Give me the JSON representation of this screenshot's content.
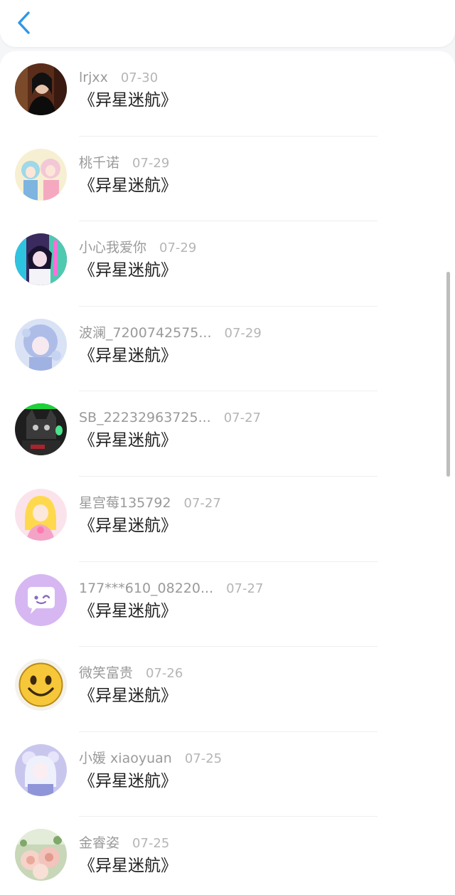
{
  "header": {
    "back_icon": "chevron-left-icon",
    "accent": "#2f96e6"
  },
  "items": [
    {
      "username": "lrjxx",
      "date": "07-30",
      "title": "《异星迷航》"
    },
    {
      "username": "桃千诺",
      "date": "07-29",
      "title": "《异星迷航》"
    },
    {
      "username": "小心我爱你",
      "date": "07-29",
      "title": "《异星迷航》"
    },
    {
      "username": "波澜_7200742575...",
      "date": "07-29",
      "title": "《异星迷航》"
    },
    {
      "username": "SB_22232963725...",
      "date": "07-27",
      "title": "《异星迷航》"
    },
    {
      "username": "星宫莓135792",
      "date": "07-27",
      "title": "《异星迷航》"
    },
    {
      "username": "177***610_08220...",
      "date": "07-27",
      "title": "《异星迷航》"
    },
    {
      "username": "微笑富贵",
      "date": "07-26",
      "title": "《异星迷航》"
    },
    {
      "username": "小媛 xiaoyuan",
      "date": "07-25",
      "title": "《异星迷航》"
    },
    {
      "username": "金睿姿",
      "date": "07-25",
      "title": "《异星迷航》"
    }
  ]
}
